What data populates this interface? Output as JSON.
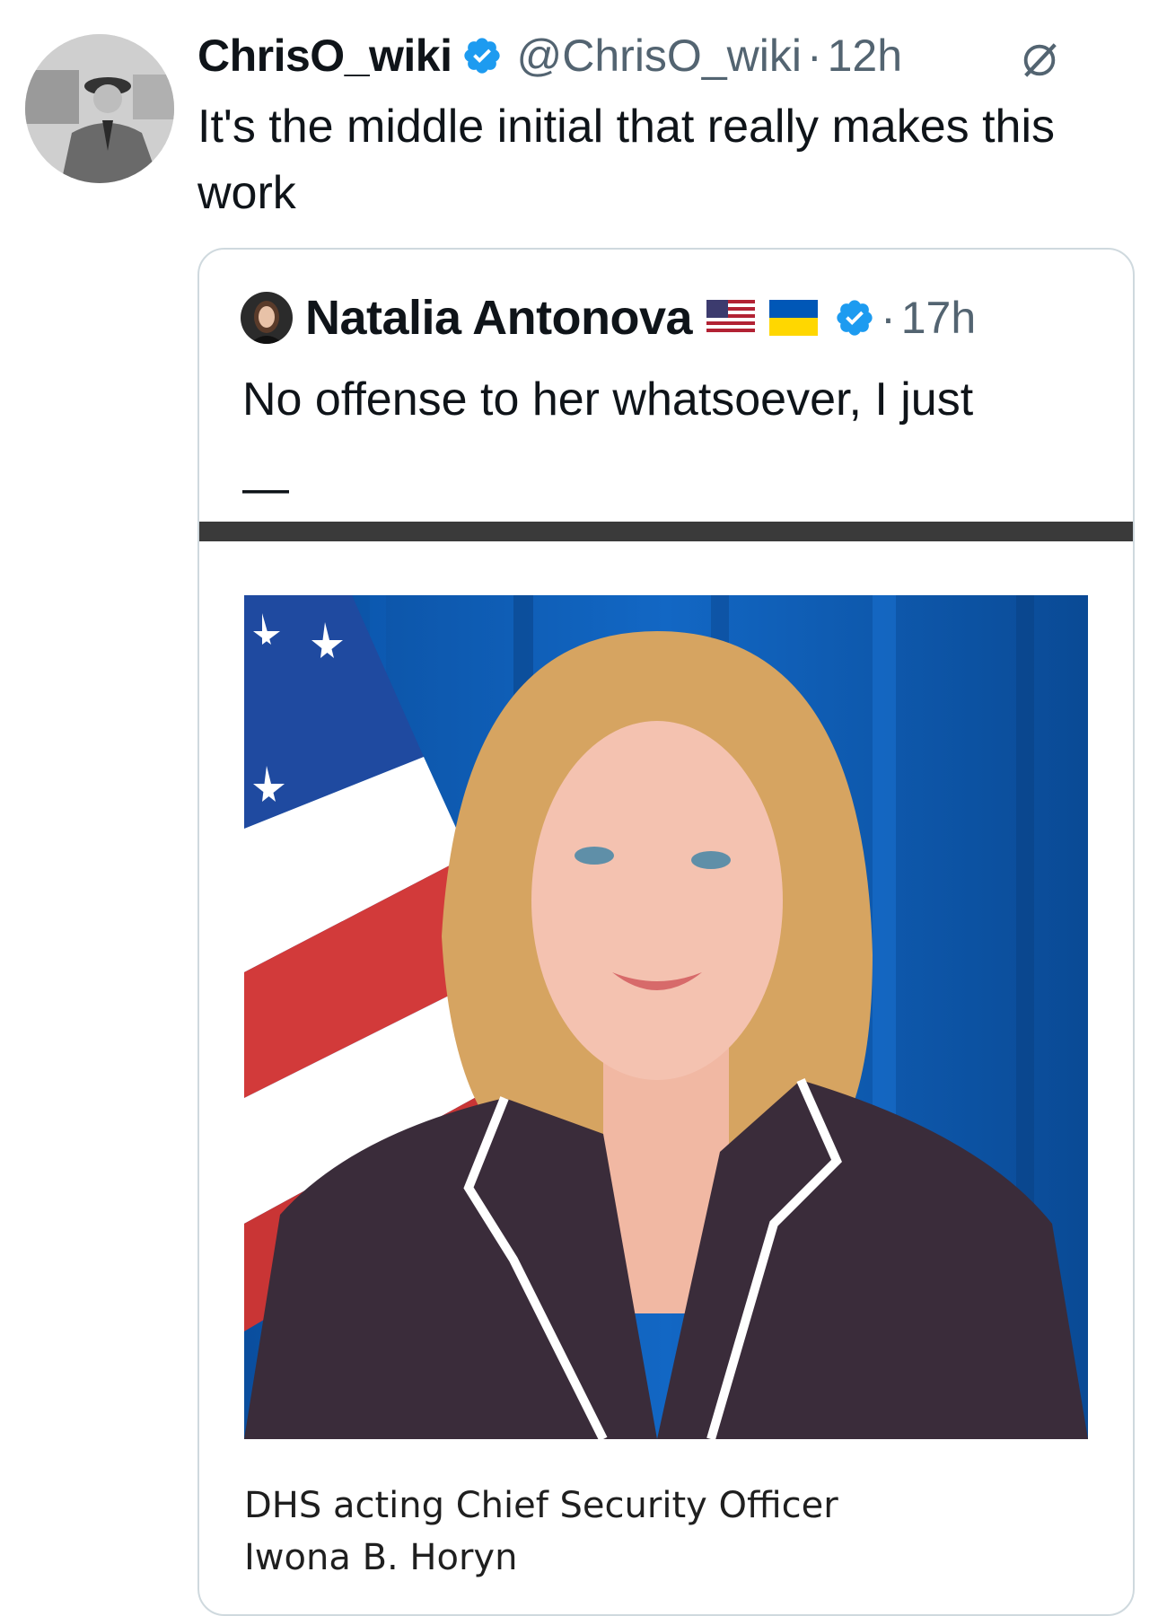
{
  "tweet": {
    "display_name": "ChrisO_wiki",
    "handle": "@ChrisO_wiki",
    "time_separator": "·",
    "time": "12h",
    "text": "It's the middle initial that really makes this work",
    "verified_icon": "verified-badge-icon",
    "extra_icon": "grok-icon"
  },
  "quote": {
    "display_name": "Natalia Antonova",
    "flags": [
      "us-flag-icon",
      "ukraine-flag-icon"
    ],
    "time_separator": "·",
    "time": "17h",
    "text": "No offense to her whatsoever, I just",
    "dash": "—",
    "caption_line_1": "DHS acting Chief Security Officer",
    "caption_line_2": "Iwona B. Horyn"
  },
  "colors": {
    "verified": "#1d9bf0",
    "secondary_text": "#536471",
    "border": "#cfd9de",
    "photo_background": "#0b56a8"
  }
}
